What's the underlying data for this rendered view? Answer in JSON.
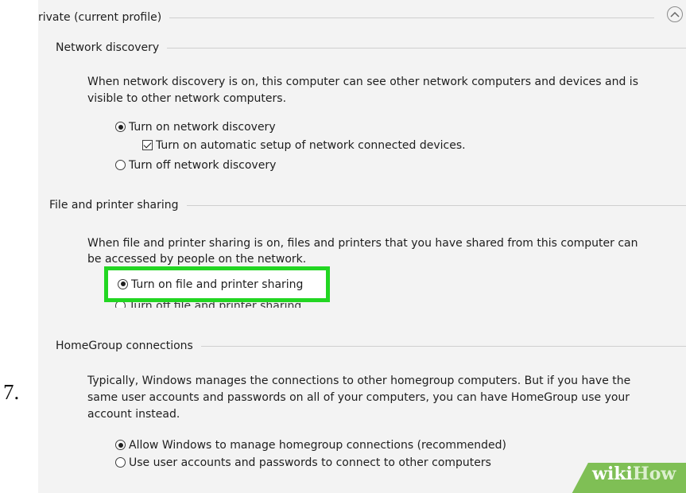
{
  "step": {
    "number": "7."
  },
  "profile": {
    "title": "rivate (current profile)"
  },
  "network_discovery": {
    "header": "Network discovery",
    "description_line1": "When network discovery is on, this computer can see other network computers and devices and is",
    "description_line2": "visible to other network computers.",
    "option_on": "Turn on network discovery",
    "option_auto": "Turn on automatic setup of network connected devices.",
    "option_off": "Turn off network discovery"
  },
  "file_sharing": {
    "header": "File and printer sharing",
    "description_line1": "When file and printer sharing is on, files and printers that you have shared from this computer can",
    "description_line2": "be accessed by people on the network.",
    "option_on": "Turn on file and printer sharing",
    "option_off": "Turn off file and printer sharing"
  },
  "homegroup": {
    "header": "HomeGroup connections",
    "description_line1": "Typically, Windows manages the connections to other homegroup computers. But if you have the",
    "description_line2": "same user accounts and passwords on all of your computers, you can have HomeGroup use your",
    "description_line3": "account instead.",
    "option_windows": "Allow Windows to manage homegroup connections (recommended)",
    "option_user": "Use user accounts and passwords to connect to other computers"
  },
  "watermark": {
    "wiki": "wiki",
    "how": "How"
  },
  "colors": {
    "highlight": "#22d622",
    "panel_bg": "#f3f3f3",
    "watermark_green": "#7fbf55"
  }
}
